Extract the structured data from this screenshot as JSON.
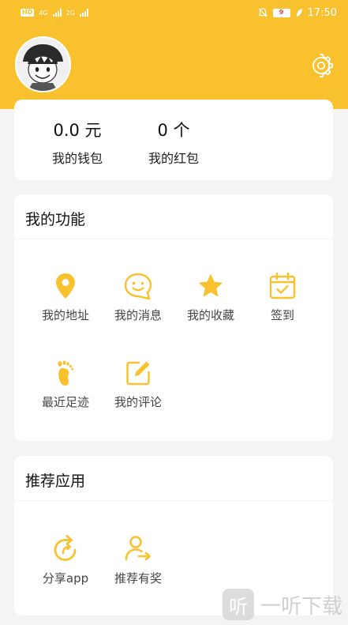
{
  "status_bar": {
    "left_badges": [
      "HD",
      "4G",
      "2G"
    ],
    "battery_level": "9",
    "time": "17:50"
  },
  "profile": {
    "avatar_icon": "avatar-cartoon-boy-icon",
    "settings_icon": "gear-icon"
  },
  "wallet": {
    "balance_value": "0.0 元",
    "balance_label": "我的钱包",
    "redpacket_value": "0 个",
    "redpacket_label": "我的红包"
  },
  "functions": {
    "title": "我的功能",
    "items": [
      {
        "label": "我的地址",
        "icon": "location-pin-icon"
      },
      {
        "label": "我的消息",
        "icon": "smiley-message-icon"
      },
      {
        "label": "我的收藏",
        "icon": "star-icon"
      },
      {
        "label": "签到",
        "icon": "calendar-check-icon"
      },
      {
        "label": "最近足迹",
        "icon": "footprint-icon"
      },
      {
        "label": "我的评论",
        "icon": "edit-comment-icon"
      }
    ]
  },
  "recommended_apps": {
    "title": "推荐应用",
    "items": [
      {
        "label": "分享app",
        "icon": "share-refresh-icon"
      },
      {
        "label": "推荐有奖",
        "icon": "user-referral-icon"
      }
    ]
  },
  "watermark": {
    "icon_char": "听",
    "text": "一听下载"
  },
  "colors": {
    "accent": "#f8c12d",
    "background": "#f4f4f4",
    "card": "#ffffff"
  }
}
